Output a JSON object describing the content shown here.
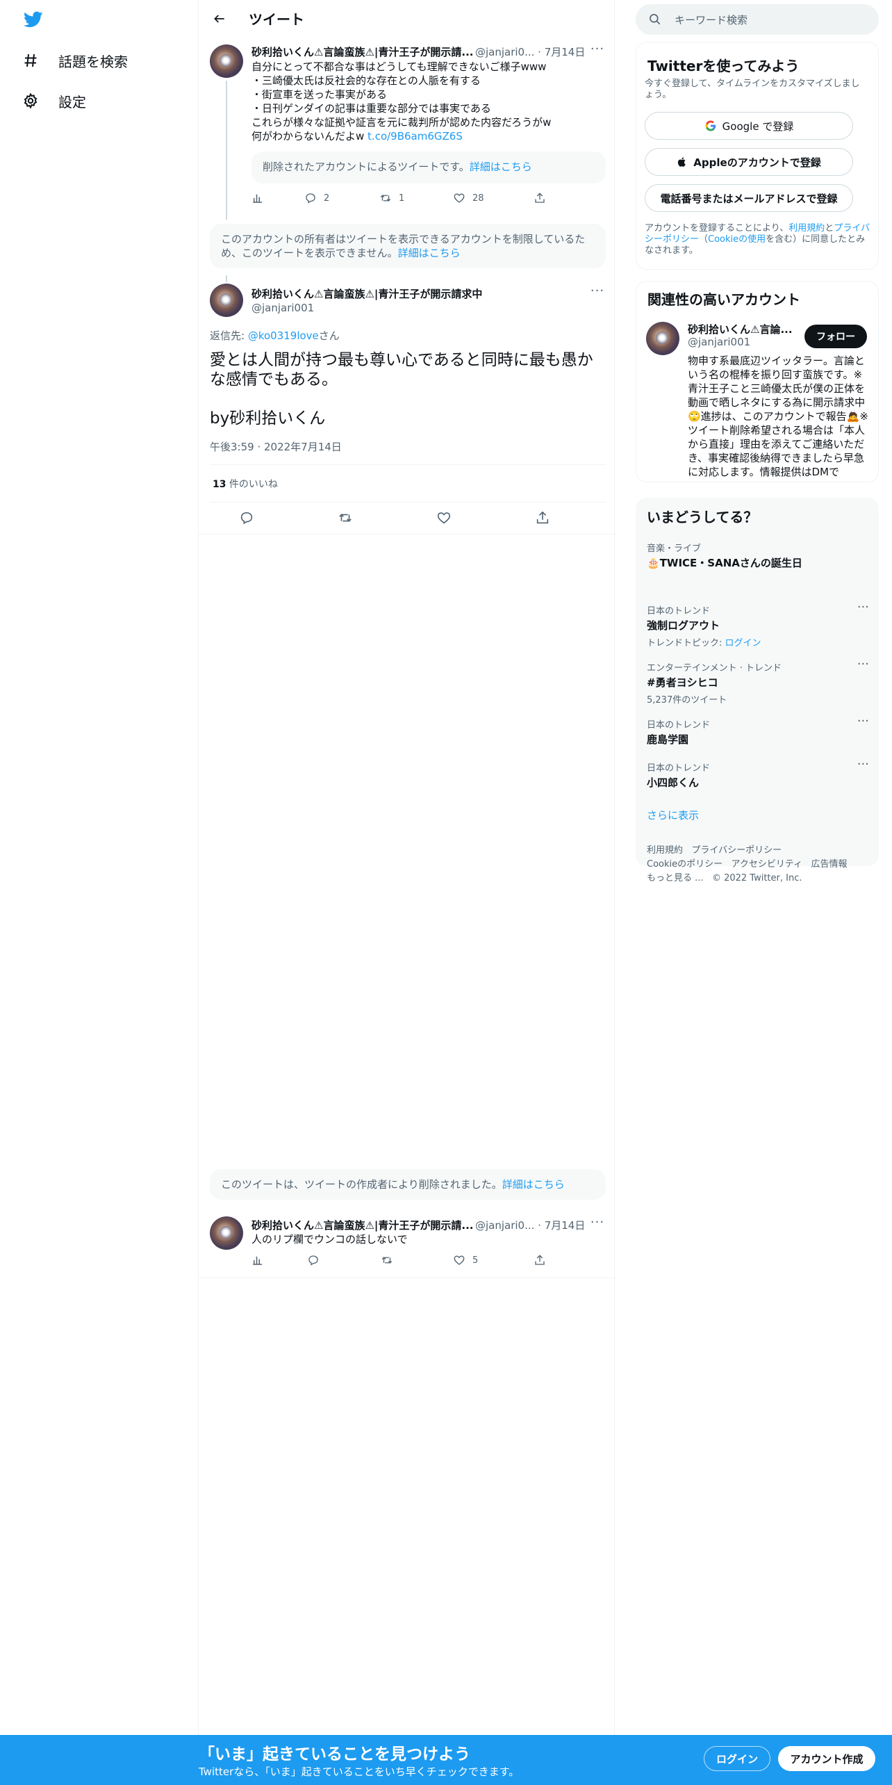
{
  "nav": {
    "explore_label": "話題を検索",
    "settings_label": "設定"
  },
  "header": {
    "title": "ツイート"
  },
  "tweet_parent": {
    "name": "砂利拾いくん⚠言論蛮族⚠|青汁王子が開示請...",
    "handle_time": "@janjari0... · 7月14日",
    "body": "自分にとって不都合な事はどうしても理解できないご様子www\n・三崎優太氏は反社会的な存在との人脈を有する\n・街宣車を送った事実がある\n・日刊ゲンダイの記事は重要な部分では事実である\nこれらが様々な証拠や証言を元に裁判所が認めた内容だろうがw\n何がわからないんだよw ",
    "link": "t.co/9B6am6GZ6S",
    "quote_notice": "削除されたアカウントによるツイートです。",
    "quote_notice_link": "詳細はこちら",
    "replies": "2",
    "retweets": "1",
    "likes": "28"
  },
  "restricted_notice": {
    "text": "このアカウントの所有者はツイートを表示できるアカウントを制限しているため、このツイートを表示できません。",
    "link": "詳細はこちら"
  },
  "main_tweet": {
    "name": "砂利拾いくん⚠言論蛮族⚠|青汁王子が開示請求中",
    "handle": "@janjari001",
    "reply_to_label": "返信先: ",
    "reply_to_user": "@ko0319love",
    "reply_to_suffix": "さん",
    "body": "愛とは人間が持つ最も尊い心であると同時に最も愚かな感情でもある。\n\nby砂利拾いくん",
    "timestamp": "午後3:59 · 2022年7月14日",
    "likes_count": "13",
    "likes_label": " 件のいいね"
  },
  "deleted_notice": {
    "text": "このツイートは、ツイートの作成者により削除されました。",
    "link": "詳細はこちら"
  },
  "reply_tweet": {
    "name": "砂利拾いくん⚠言論蛮族⚠|青汁王子が開示請...",
    "handle_time": "@janjari0... · 7月14日",
    "body": "人のリプ欄でウンコの話しないで",
    "likes": "5"
  },
  "search": {
    "placeholder": "キーワード検索"
  },
  "signup_card": {
    "title": "Twitterを使ってみよう",
    "subtitle": "今すぐ登録して、タイムラインをカスタマイズしましょう。",
    "google_label": "Google で登録",
    "apple_label": "Appleのアカウントで登録",
    "phone_label": "電話番号またはメールアドレスで登録",
    "legal_pre": "アカウントを登録することにより、",
    "legal_link1": "利用規約",
    "legal_mid": "と",
    "legal_link2": "プライバシーポリシー",
    "legal_mid2": "（",
    "legal_link3": "Cookieの使用",
    "legal_post": "を含む）に同意したとみなされます。"
  },
  "related_card": {
    "title": "関連性の高いアカウント",
    "name": "砂利拾いくん⚠言論...",
    "handle": "@janjari001",
    "follow_label": "フォロー",
    "bio": "物申す系最底辺ツイッタラー。言論という名の棍棒を振り回す蛮族です。※青汁王子こと三崎優太氏が僕の正体を動画で晒しネタにする為に開示請求中🙄進捗は、このアカウントで報告🙇※ツイート削除希望される場合は「本人から直接」理由を添えてご連絡いただき、事実確認後納得できましたら早急に対応します。情報提供はDMで"
  },
  "trends_card": {
    "title": "いまどうしてる？",
    "show_more": "さらに表示",
    "items": [
      {
        "context": "音楽・ライブ",
        "title": "🎂TWICE・SANAさんの誕生日",
        "sub": ""
      },
      {
        "context": "日本のトレンド",
        "title": "強制ログアウト",
        "sub_pre": "トレンドトピック: ",
        "sub_link": "ログイン"
      },
      {
        "context": "エンターテインメント · トレンド",
        "title": "#勇者ヨシヒコ",
        "sub": "5,237件のツイート"
      },
      {
        "context": "日本のトレンド",
        "title": "鹿島学園",
        "sub": ""
      },
      {
        "context": "日本のトレンド",
        "title": "小四郎くん",
        "sub": ""
      }
    ]
  },
  "footer": {
    "terms": "利用規約",
    "privacy": "プライバシーポリシー",
    "cookies": "Cookieのポリシー",
    "accessibility": "アクセシビリティ",
    "ads": "広告情報",
    "more": "もっと見る ...",
    "copyright": "© 2022 Twitter, Inc."
  },
  "banner": {
    "title": "「いま」起きていることを見つけよう",
    "subtitle": "Twitterなら、「いま」起きていることをいち早くチェックできます。",
    "login_label": "ログイン",
    "signup_label": "アカウント作成"
  },
  "colors": {
    "accent": "#1d9bf0",
    "text": "#0f1419",
    "muted": "#536471"
  }
}
